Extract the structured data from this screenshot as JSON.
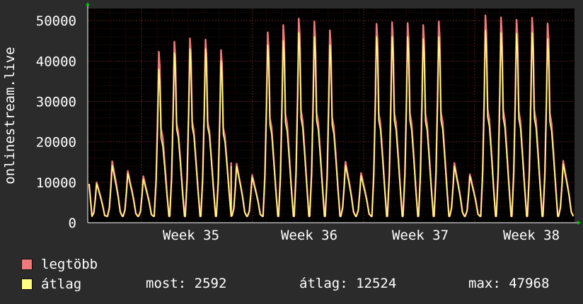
{
  "chart_data": {
    "type": "area",
    "ylabel": "onlinestream.live",
    "ylim": [
      0,
      53000
    ],
    "yticks": [
      0,
      10000,
      20000,
      30000,
      40000,
      50000
    ],
    "xticks": [
      "Week 35",
      "Week 36",
      "Week 37",
      "Week 38"
    ],
    "grid": true,
    "colors": {
      "background": "#2b2b2b",
      "plot": "#000000",
      "grid": "#5a2020",
      "max": "#f07a7a",
      "avg": "#ffff80"
    },
    "series": [
      {
        "name": "legtöbb",
        "values": [
          10000,
          15200,
          12800,
          11500,
          42300,
          44800,
          45600,
          45300,
          42700,
          14600,
          11800,
          47100,
          48900,
          50500,
          49800,
          47600,
          15100,
          12300,
          49200,
          49600,
          49400,
          48900,
          49800,
          14800,
          12000,
          51300,
          50800,
          50200,
          50700,
          49300,
          15300
        ]
      },
      {
        "name": "átlag",
        "values": [
          9600,
          14100,
          12200,
          10800,
          38000,
          42000,
          43000,
          43000,
          40000,
          14000,
          11200,
          44000,
          45000,
          47000,
          46000,
          44000,
          14200,
          11600,
          46000,
          46000,
          46000,
          45500,
          46000,
          14000,
          11500,
          47600,
          47000,
          46800,
          47000,
          45500,
          14500
        ]
      }
    ],
    "legend": [
      {
        "label": "legtöbb",
        "color": "#f07a7a"
      },
      {
        "label": "átlag",
        "color": "#ffff80"
      }
    ],
    "stats": {
      "now_label": "most:",
      "now_value": "2592",
      "avg_label": "átlag:",
      "avg_value": "12524",
      "max_label": "max:",
      "max_value": "47968"
    }
  }
}
